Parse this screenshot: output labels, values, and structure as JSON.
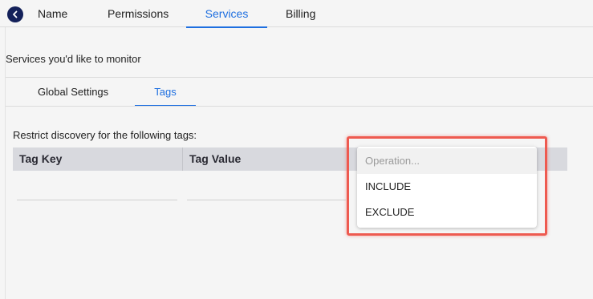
{
  "top_tabs": [
    {
      "label": "Name"
    },
    {
      "label": "Permissions"
    },
    {
      "label": "Services"
    },
    {
      "label": "Billing"
    }
  ],
  "active_top_tab": "Services",
  "section_title": "Services you'd like to monitor",
  "sub_tabs": [
    {
      "label": "Global Settings"
    },
    {
      "label": "Tags"
    }
  ],
  "active_sub_tab": "Tags",
  "restrict_label": "Restrict discovery for the following tags:",
  "table": {
    "columns": [
      "Tag Key",
      "Tag Value"
    ]
  },
  "operation_dropdown": {
    "placeholder": "Operation...",
    "options": [
      "INCLUDE",
      "EXCLUDE"
    ]
  },
  "colors": {
    "accent": "#1e6fe0",
    "highlight": "#ee5a50",
    "back_button": "#14215a"
  },
  "icons": {
    "back": "chevron-left-icon"
  }
}
